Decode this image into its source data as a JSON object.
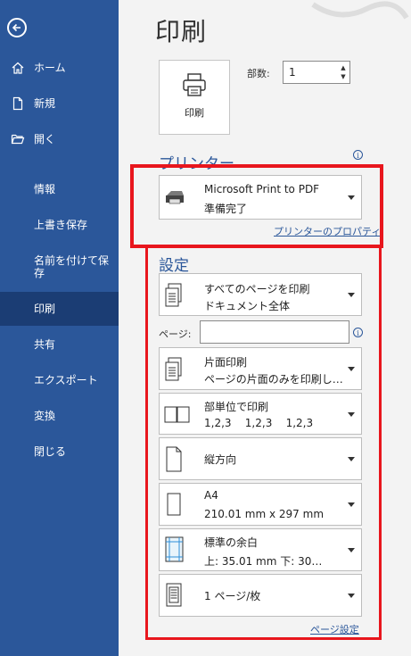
{
  "sidebar": {
    "back_icon": "back-arrow-icon",
    "items": [
      {
        "label": "ホーム",
        "icon": "home-icon"
      },
      {
        "label": "新規",
        "icon": "new-document-icon"
      },
      {
        "label": "開く",
        "icon": "open-folder-icon"
      },
      {
        "label": "情報"
      },
      {
        "label": "上書き保存"
      },
      {
        "label": "名前を付けて保存"
      },
      {
        "label": "印刷",
        "active": true
      },
      {
        "label": "共有"
      },
      {
        "label": "エクスポート"
      },
      {
        "label": "変換"
      },
      {
        "label": "閉じる"
      }
    ]
  },
  "main": {
    "title": "印刷",
    "print_button_label": "印刷",
    "copies_label": "部数:",
    "copies_value": "1",
    "printer_section_title": "プリンター",
    "printer": {
      "name": "Microsoft Print to PDF",
      "status": "準備完了",
      "icon": "printer-icon"
    },
    "printer_properties_link": "プリンターのプロパティ",
    "settings_section_title": "設定",
    "settings": [
      {
        "line1": "すべてのページを印刷",
        "line2": "ドキュメント全体",
        "icon": "all-pages-icon"
      },
      {
        "line1": "片面印刷",
        "line2": "ページの片面のみを印刷し…",
        "icon": "one-sided-icon"
      },
      {
        "line1": "部単位で印刷",
        "line2": "1,2,3    1,2,3    1,2,3",
        "icon": "collated-icon"
      },
      {
        "line1": "縦方向",
        "line2": "",
        "icon": "portrait-icon"
      },
      {
        "line1": "A4",
        "line2": "210.01 mm x 297 mm",
        "icon": "paper-size-icon"
      },
      {
        "line1": "標準の余白",
        "line2": "上: 35.01 mm 下: 30…",
        "icon": "margins-icon"
      },
      {
        "line1": "1 ページ/枚",
        "line2": "",
        "icon": "pages-per-sheet-icon"
      }
    ],
    "pages_label": "ページ:",
    "pages_value": "",
    "page_setup_link": "ページ設定"
  },
  "colors": {
    "sidebar_bg": "#2b579a",
    "sidebar_active": "#1b3d74",
    "accent": "#2b579a",
    "highlight": "#e8161d"
  }
}
